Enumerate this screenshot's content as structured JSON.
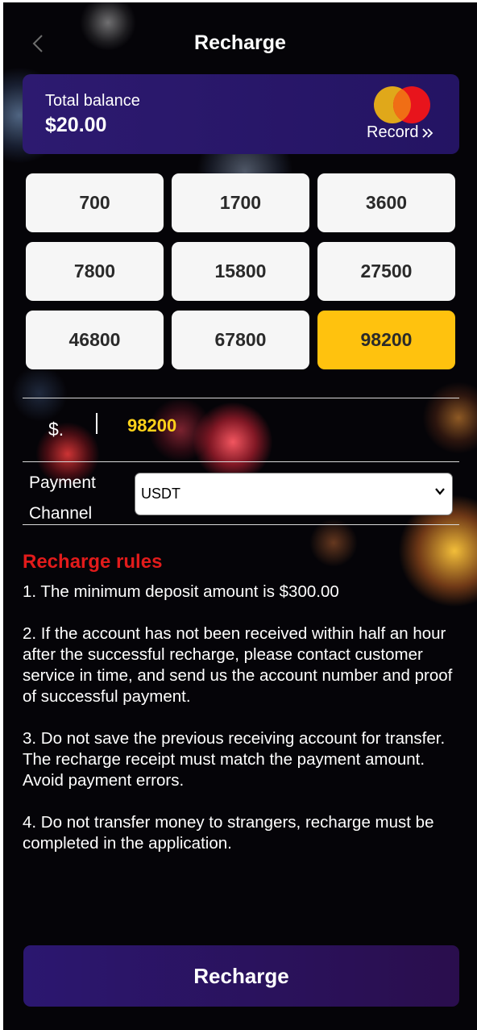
{
  "header": {
    "title": "Recharge",
    "back_icon": "chevron-left-icon"
  },
  "balance": {
    "label": "Total balance",
    "value": "$20.00",
    "record_label": "Record",
    "record_icon": "double-chevron-right-icon",
    "card_icon": "mastercard-logo-icon"
  },
  "amounts": [
    {
      "label": "700",
      "selected": false
    },
    {
      "label": "1700",
      "selected": false
    },
    {
      "label": "3600",
      "selected": false
    },
    {
      "label": "7800",
      "selected": false
    },
    {
      "label": "15800",
      "selected": false
    },
    {
      "label": "27500",
      "selected": false
    },
    {
      "label": "46800",
      "selected": false
    },
    {
      "label": "67800",
      "selected": false
    },
    {
      "label": "98200",
      "selected": true
    }
  ],
  "amount_input": {
    "currency": "$.",
    "value": "98200"
  },
  "payment": {
    "label_line1": "Payment",
    "label_line2": "Channel",
    "selected": "USDT"
  },
  "rules": {
    "title": "Recharge rules",
    "items": [
      "1. The minimum deposit amount is $300.00",
      "2. If the account has not been received within half an hour after the successful recharge, please contact customer service in time, and send us the account number and proof of successful payment.",
      "3. Do not save the previous receiving account for transfer. The recharge receipt must match the payment amount. Avoid payment errors.",
      "4. Do not transfer money to strangers, recharge must be completed in the application."
    ]
  },
  "recharge_button": "Recharge",
  "colors": {
    "accent_yellow": "#ffc20e",
    "card_purple": "#2d1a70",
    "rules_red": "#e21b1b",
    "amount_yellow": "#ffd21a"
  }
}
